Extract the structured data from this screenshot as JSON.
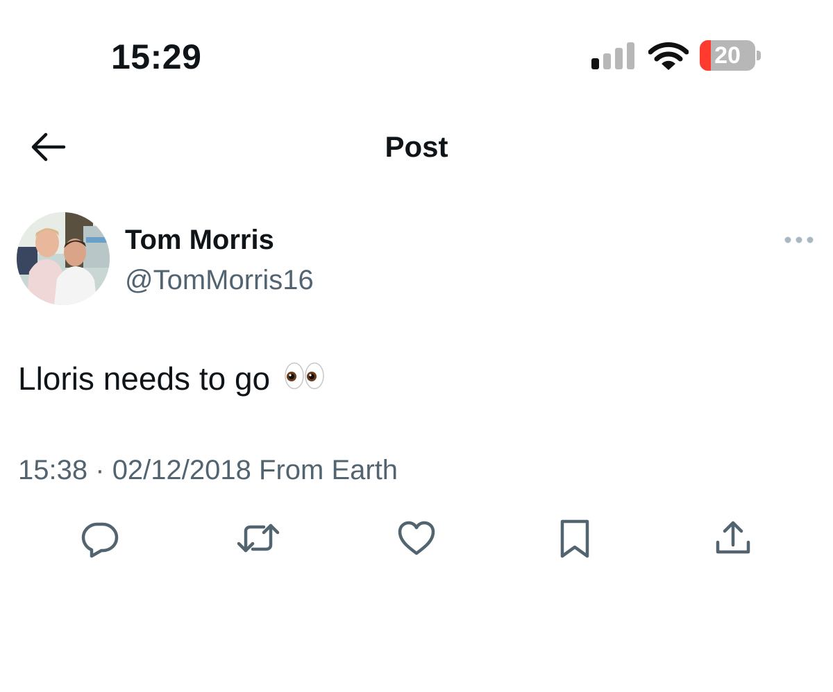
{
  "status_bar": {
    "time": "15:29",
    "battery_level": "20",
    "battery_percent": 20,
    "battery_low_color": "#ff3b30",
    "signal_icon": "cellular-signal-icon",
    "wifi_icon": "wifi-icon"
  },
  "header": {
    "title": "Post",
    "back_icon": "arrow-left-icon"
  },
  "author": {
    "name": "Tom Morris",
    "handle": "@TomMorris16",
    "avatar_icon": "avatar-photo",
    "more_icon": "more-horizontal-icon"
  },
  "post": {
    "text": "Lloris needs to go",
    "emoji": "eyes-emoji",
    "time": "15:38",
    "separator": "·",
    "date": "02/12/2018",
    "source": "From Earth"
  },
  "actions": [
    {
      "name": "reply",
      "icon": "reply-icon"
    },
    {
      "name": "repost",
      "icon": "repost-icon"
    },
    {
      "name": "like",
      "icon": "heart-icon"
    },
    {
      "name": "bookmark",
      "icon": "bookmark-icon"
    },
    {
      "name": "share",
      "icon": "share-icon"
    }
  ],
  "colors": {
    "text_primary": "#0f1419",
    "text_secondary": "#536471",
    "background": "#ffffff"
  }
}
